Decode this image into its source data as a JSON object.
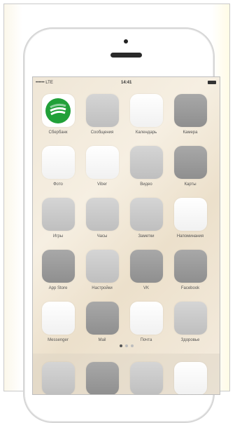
{
  "status": {
    "carrier": "•••••• LTE",
    "time": "14:41"
  },
  "apps": [
    {
      "label": "Сбербанк",
      "icon": "sberbank-icon",
      "tone": "sber"
    },
    {
      "label": "Сообщения",
      "icon": "app-icon",
      "tone": "mid"
    },
    {
      "label": "Календарь",
      "icon": "app-icon",
      "tone": "light"
    },
    {
      "label": "Камера",
      "icon": "app-icon",
      "tone": "dark"
    },
    {
      "label": "Фото",
      "icon": "app-icon",
      "tone": "light"
    },
    {
      "label": "Viber",
      "icon": "app-icon",
      "tone": "light"
    },
    {
      "label": "Видео",
      "icon": "app-icon",
      "tone": "mid"
    },
    {
      "label": "Карты",
      "icon": "app-icon",
      "tone": "dark"
    },
    {
      "label": "Игры",
      "icon": "app-icon",
      "tone": "mid"
    },
    {
      "label": "Часы",
      "icon": "app-icon",
      "tone": "mid"
    },
    {
      "label": "Заметки",
      "icon": "app-icon",
      "tone": "mid"
    },
    {
      "label": "Напоминания",
      "icon": "app-icon",
      "tone": "light"
    },
    {
      "label": "App Store",
      "icon": "app-icon",
      "tone": "dark"
    },
    {
      "label": "Настройки",
      "icon": "app-icon",
      "tone": "mid"
    },
    {
      "label": "VK",
      "icon": "app-icon",
      "tone": "dark"
    },
    {
      "label": "Facebook",
      "icon": "app-icon",
      "tone": "dark"
    },
    {
      "label": "Messenger",
      "icon": "app-icon",
      "tone": "light"
    },
    {
      "label": "Mail",
      "icon": "app-icon",
      "tone": "dark"
    },
    {
      "label": "Почта",
      "icon": "app-icon",
      "tone": "light"
    },
    {
      "label": "Здоровье",
      "icon": "app-icon",
      "tone": "mid"
    }
  ],
  "dock": [
    {
      "icon": "app-icon",
      "tone": "mid"
    },
    {
      "icon": "app-icon",
      "tone": "dark"
    },
    {
      "icon": "app-icon",
      "tone": "mid"
    },
    {
      "icon": "app-icon",
      "tone": "light"
    }
  ],
  "page_dots": 3,
  "active_dot": 0,
  "colors": {
    "sber_green": "#21a038",
    "sber_light": "#8fd19e"
  }
}
